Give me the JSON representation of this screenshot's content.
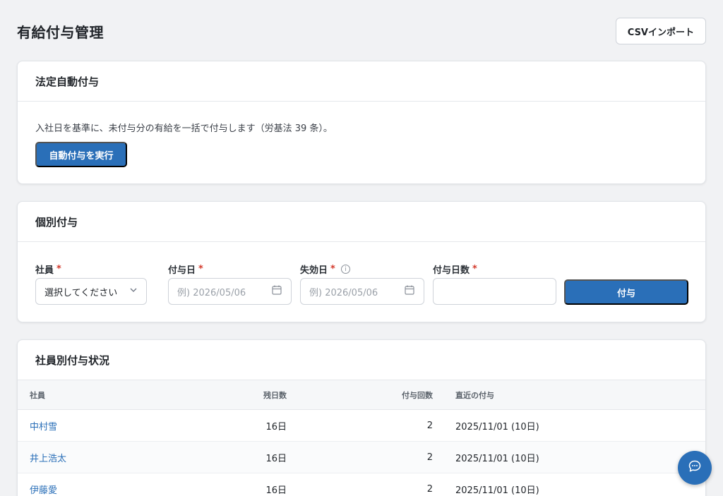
{
  "header": {
    "title": "有給付与管理",
    "csv_import_label": "CSVインポート"
  },
  "auto_grant": {
    "title": "法定自動付与",
    "description": "入社日を基準に、未付与分の有給を一括で付与します（労基法 39 条）。",
    "run_label": "自動付与を実行"
  },
  "individual_grant": {
    "title": "個別付与",
    "employee_label": "社員",
    "employee_value": "選択してください",
    "grant_date_label": "付与日",
    "grant_date_placeholder": "例) 2026/05/06",
    "expiry_date_label": "失効日",
    "expiry_date_placeholder": "例) 2026/05/06",
    "days_label": "付与日数",
    "days_value": "",
    "required_mark": "*",
    "submit_label": "付与"
  },
  "status": {
    "title": "社員別付与状況",
    "columns": [
      "社員",
      "残日数",
      "付与回数",
      "直近の付与"
    ],
    "rows": [
      {
        "name": "中村雪",
        "remaining": "16日",
        "count": "2",
        "recent": "2025/11/01 (10日)"
      },
      {
        "name": "井上浩太",
        "remaining": "16日",
        "count": "2",
        "recent": "2025/11/01 (10日)"
      },
      {
        "name": "伊藤愛",
        "remaining": "16日",
        "count": "2",
        "recent": "2025/11/01 (10日)"
      }
    ]
  },
  "colors": {
    "primary": "#2a6fb8",
    "required": "#d33a2c",
    "background": "#f1f2f4"
  },
  "icons": {
    "calendar": "calendar-icon",
    "chevron": "chevron-down-icon",
    "info": "info-icon",
    "chat": "chat-icon"
  }
}
